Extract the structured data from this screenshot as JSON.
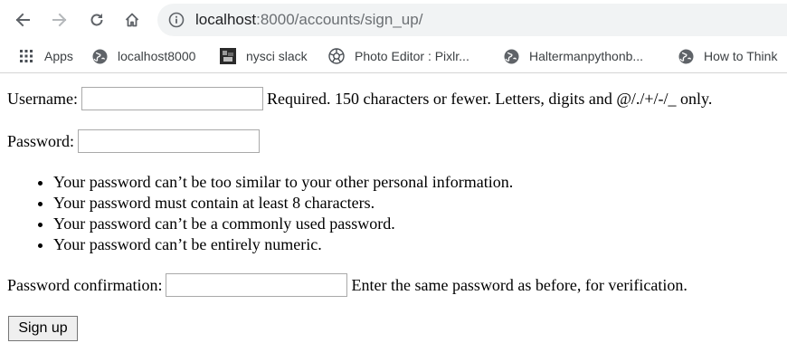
{
  "browser": {
    "url_host": "localhost",
    "url_path": ":8000/accounts/sign_up/",
    "bookmarks": [
      {
        "label": "Apps",
        "icon": "apps-grid-icon"
      },
      {
        "label": "localhost8000",
        "icon": "globe-icon"
      },
      {
        "label": "nysci slack",
        "icon": "image-favicon-icon"
      },
      {
        "label": "Photo Editor : Pixlr...",
        "icon": "aperture-icon"
      },
      {
        "label": "Haltermanpythonb...",
        "icon": "globe-icon"
      },
      {
        "label": "How to Think",
        "icon": "globe-icon"
      }
    ]
  },
  "form": {
    "username_label": "Username:",
    "username_value": "",
    "username_help": "Required. 150 characters or fewer. Letters, digits and @/./+/-/_ only.",
    "password_label": "Password:",
    "password_value": "",
    "password_rules": [
      "Your password can’t be too similar to your other personal information.",
      "Your password must contain at least 8 characters.",
      "Your password can’t be a commonly used password.",
      "Your password can’t be entirely numeric."
    ],
    "confirm_label": "Password confirmation:",
    "confirm_value": "",
    "confirm_help": "Enter the same password as before, for verification.",
    "submit_label": "Sign up"
  },
  "colors": {
    "omnibox_bg": "#f1f3f4",
    "icon_gray": "#5f6368",
    "input_border": "#a9a9a9",
    "button_bg": "#efefef"
  }
}
